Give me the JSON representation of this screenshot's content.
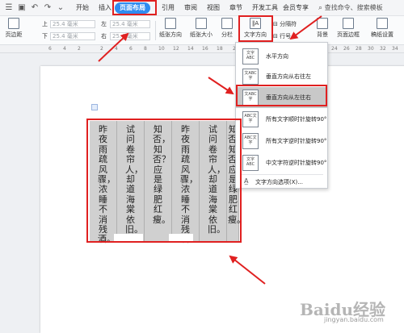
{
  "menubar": {
    "tabs": [
      {
        "id": "start",
        "label": "开始"
      },
      {
        "id": "insert",
        "label": "插入"
      },
      {
        "id": "layout",
        "label": "页面布局"
      },
      {
        "id": "ref",
        "label": "引用"
      },
      {
        "id": "review",
        "label": "审阅"
      },
      {
        "id": "view",
        "label": "视图"
      },
      {
        "id": "section",
        "label": "章节"
      },
      {
        "id": "dev",
        "label": "开发工具"
      },
      {
        "id": "vip",
        "label": "会员专享"
      }
    ],
    "active_tab": "页面布局",
    "search_placeholder": "查找命令、搜索模板"
  },
  "ribbon": {
    "margins_label": "页边距",
    "top_label": "上",
    "bottom_label": "下",
    "top_value": "25.4 毫米",
    "bottom_value": "25.4 毫米",
    "left_label": "左",
    "right_label": "右",
    "left_value": "25.4 毫米",
    "right_value": "25.4 毫米",
    "orientation_label": "纸张方向",
    "size_label": "纸张大小",
    "columns_label": "分栏",
    "text_direction_label": "文字方向",
    "break_label": "分隔符",
    "line_number_label": "行号",
    "background_label": "背景",
    "page_border_label": "页面边框",
    "paper_settings_label": "稿纸设置"
  },
  "ruler": {
    "ticks": [
      "6",
      "4",
      "2",
      "2",
      "4",
      "6",
      "8",
      "10",
      "12",
      "14",
      "16",
      "18",
      "22",
      "24",
      "26",
      "28",
      "30",
      "32",
      "34"
    ]
  },
  "dropdown": {
    "items": [
      {
        "label": "水平方向",
        "icon": "horizontal-text-icon",
        "icon_text": "文字ABC"
      },
      {
        "label": "垂直方向从右往左",
        "icon": "vertical-right-to-left-icon",
        "icon_text": "文ABC字"
      },
      {
        "label": "垂直方向从左往右",
        "icon": "vertical-left-to-right-icon",
        "icon_text": "文ABC字"
      },
      {
        "label": "所有文字顺时针旋转90°",
        "icon": "rotate-clockwise-icon",
        "icon_text": "ABC文字"
      },
      {
        "label": "所有文字逆时针旋转90°",
        "icon": "rotate-counterclockwise-icon",
        "icon_text": "ABC文字"
      },
      {
        "label": "中文字符逆时针旋转90°",
        "icon": "cjk-rotate-counterclockwise-icon",
        "icon_text": "文字ABC"
      }
    ],
    "selected": "垂直方向从左往右",
    "options_label": "文字方向选项(X)..."
  },
  "document": {
    "columns": [
      "昨夜雨疏风骤，浓睡不消残酒。",
      "试问卷帘人，却道海棠依旧。",
      "知否，知否？应是绿肥红瘦。",
      "昨夜雨疏风骤，浓睡不消残酒。",
      "试问卷帘人，却道海棠依旧。",
      "知否，知否？应是绿肥红瘦。"
    ]
  },
  "watermark": {
    "logo": "Baidu经验",
    "url": "jingyan.baidu.com"
  },
  "colors": {
    "accent": "#2f8cf0",
    "highlight": "#e02020",
    "table_fill": "#d0d0d0"
  }
}
